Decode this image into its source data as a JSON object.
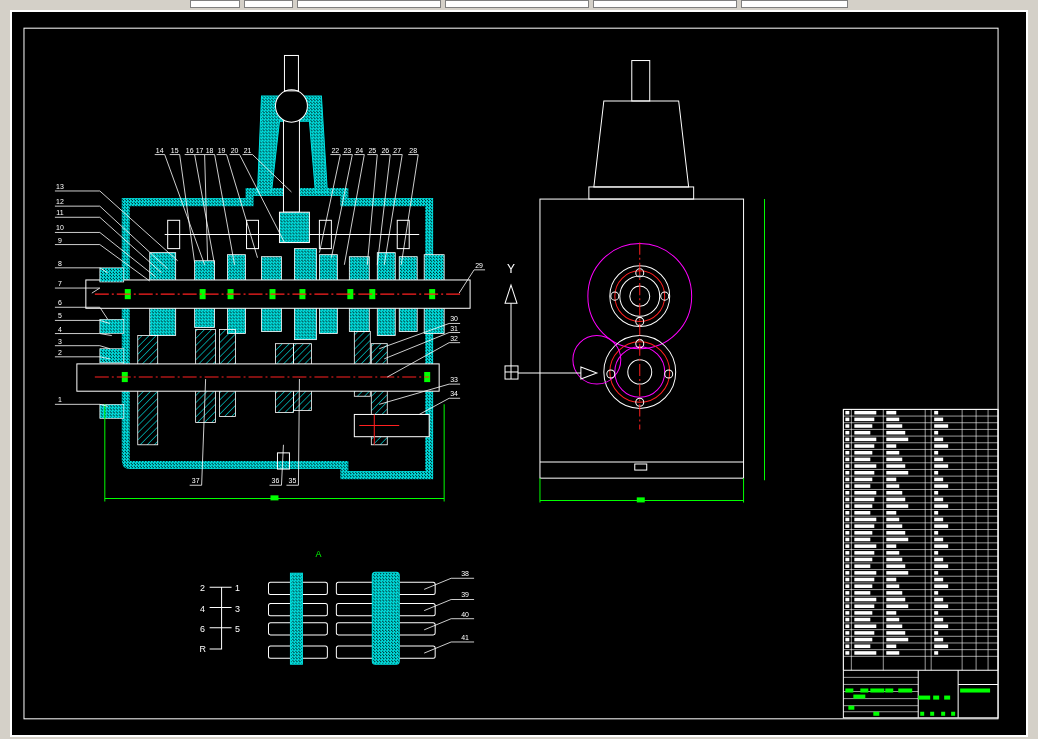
{
  "section_view": {
    "left_callouts": [
      "13",
      "12",
      "11",
      "10",
      "9",
      "8",
      "7",
      "6",
      "5",
      "4",
      "3",
      "2",
      "1"
    ],
    "top_callouts": [
      "14",
      "15",
      "16",
      "17",
      "18",
      "19",
      "20",
      "21",
      "22",
      "23",
      "24",
      "25",
      "26",
      "27",
      "28"
    ],
    "right_callouts": [
      "29",
      "30",
      "31",
      "32",
      "33",
      "34"
    ],
    "bottom_callouts": [
      "37",
      "36",
      "35"
    ]
  },
  "side_view": {
    "axis_label": "Y"
  },
  "detail_view": {
    "title": "A",
    "shift_pattern": [
      "2",
      "1",
      "4",
      "3",
      "6",
      "5",
      "R"
    ],
    "fork_callouts": [
      "38",
      "39",
      "40",
      "41"
    ]
  }
}
